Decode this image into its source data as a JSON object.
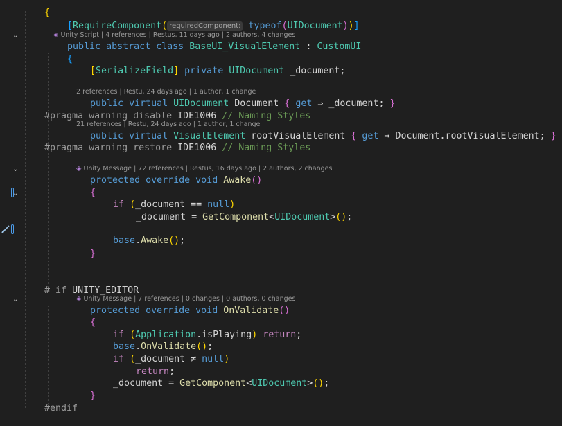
{
  "code": {
    "l_brace_top": "{",
    "l_attr": {
      "open": "[",
      "name": "RequireComponent",
      "paren_open": "(",
      "hint": "requiredComponent:",
      "typeof": "typeof",
      "arg_open": "(",
      "arg": "UIDocument",
      "arg_close": ")",
      "paren_close": ")",
      "close": "]"
    },
    "lens1": {
      "kind": "Unity Script",
      "rest": " | 4 references | Restus, 11 days ago | 2 authors, 4 changes"
    },
    "l_class": {
      "kw1": "public",
      "kw2": "abstract",
      "kw3": "class",
      "name": "BaseUI_VisualElement",
      "colon": " : ",
      "base": "CustomUI"
    },
    "l_brace_class": "{",
    "l_field": {
      "open": "[",
      "attr": "SerializeField",
      "close": "]",
      "kw": "private",
      "type": "UIDocument",
      "name": " _document;"
    },
    "lens2": "2 references | Restu, 24 days ago | 1 author, 1 change",
    "l_doc": {
      "kw1": "public",
      "kw2": "virtual",
      "type": "UIDocument",
      "name": "Document",
      "open": "{",
      "get": "get",
      "arrow": "⇒",
      "expr": " _document; ",
      "close": "}"
    },
    "l_pragma1": {
      "kw": "#pragma",
      "rest": " warning disable ",
      "code": "IDE1006",
      "comment": "// Naming Styles"
    },
    "lens3": "21 references | Restu, 24 days ago | 1 author, 1 change",
    "l_root": {
      "kw1": "public",
      "kw2": "virtual",
      "type": "VisualElement",
      "name": "rootVisualElement",
      "open": "{",
      "get": "get",
      "arrow": "⇒",
      "expr": " Document.rootVisualElement; ",
      "close": "}"
    },
    "l_pragma2": {
      "kw": "#pragma",
      "rest": " warning restore ",
      "code": "IDE1006",
      "comment": "// Naming Styles"
    },
    "lens4": {
      "kind": "Unity Message",
      "rest": " | 72 references | Restus, 16 days ago | 2 authors, 2 changes"
    },
    "l_awake": {
      "kw1": "protected",
      "kw2": "override",
      "kw3": "void",
      "name": "Awake",
      "parens": "()"
    },
    "l_awake_open": "{",
    "l_if1": {
      "kw": "if",
      "open": "(",
      "expr": "_document == ",
      "null": "null",
      "close": ")"
    },
    "l_assign1": {
      "lhs": "_document = ",
      "m": "GetComponent",
      "lt": "<",
      "type": "UIDocument",
      "gt": ">",
      "call": "()",
      "semi": ";"
    },
    "l_base_awake": {
      "kw": "base",
      "dot": ".",
      "m": "Awake",
      "call": "()",
      "semi": ";"
    },
    "l_awake_close": "}",
    "l_if_editor": {
      "hash": "# if",
      "sym": " UNITY_EDITOR"
    },
    "lens5": {
      "kind": "Unity Message",
      "rest": " | 7 references | 0 changes | 0 authors, 0 changes"
    },
    "l_onvalidate": {
      "kw1": "protected",
      "kw2": "override",
      "kw3": "void",
      "name": "OnValidate",
      "parens": "()"
    },
    "l_ov_open": "{",
    "l_if2": {
      "kw": "if",
      "open": "(",
      "type": "Application",
      "expr": ".isPlaying",
      "close": ")",
      "ret": "return",
      "semi": ";"
    },
    "l_base_ov": {
      "kw": "base",
      "dot": ".",
      "m": "OnValidate",
      "call": "()",
      "semi": ";"
    },
    "l_if3": {
      "kw": "if",
      "open": "(",
      "expr": "_document ≠ ",
      "null": "null",
      "close": ")"
    },
    "l_return": {
      "kw": "return",
      "semi": ";"
    },
    "l_assign2": {
      "lhs": "_document = ",
      "m": "GetComponent",
      "lt": "<",
      "type": "UIDocument",
      "gt": ">",
      "call": "()",
      "semi": ";"
    },
    "l_ov_close": "}",
    "l_endif": "#endif"
  },
  "icons": {
    "fold": "chevron-down-icon",
    "lens_unity": "unity-icon",
    "brush": "paintbrush-icon",
    "modified": "modified-marker"
  },
  "colors": {
    "background": "#1f1f1f",
    "keyword": "#569cd6",
    "control": "#c586c0",
    "type": "#4ec9b0",
    "method": "#dcdcaa",
    "comment": "#6a9955",
    "bracket_gold": "#ffd700",
    "bracket_orchid": "#da70d6",
    "bracket_blue": "#179fff"
  }
}
